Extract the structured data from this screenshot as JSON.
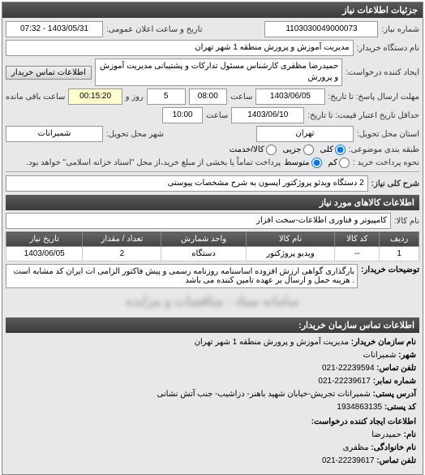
{
  "header": {
    "title": "جزئیات اطلاعات نیاز"
  },
  "fields": {
    "need_number_label": "شماره نیاز:",
    "need_number": "1103030049000073",
    "announce_datetime_label": "تاریخ و ساعت اعلان عمومی:",
    "announce_datetime": "1403/05/31 - 07:32",
    "buyer_org_label": "نام دستگاه خریدار:",
    "buyer_org": "مدیریت آموزش و پرورش منطقه 1 شهر تهران",
    "requester_label": "ایجاد کننده درخواست:",
    "requester": "حمیدرضا مظفری کارشناس مسئول تدارکات و پشتیبانی مدیریت آموزش و پرورش",
    "contact_btn": "اطلاعات تماس خریدار",
    "deadline_label": "مهلت ارسال پاسخ: تا تاریخ:",
    "deadline_date": "1403/06/05",
    "deadline_time_label": "ساعت",
    "deadline_time": "08:00",
    "remaining_days": "5",
    "remaining_days_label": "روز و",
    "remaining_time": "00:15:20",
    "remaining_label": "ساعت باقی مانده",
    "validity_label": "حداقل تاریخ اعتبار قیمت: تا تاریخ:",
    "validity_date": "1403/06/10",
    "validity_time_label": "ساعت",
    "validity_time": "10:00",
    "province_label": "استان محل تحویل:",
    "province": "تهران",
    "city_label": "شهر محل تحویل:",
    "city": "شمیرانات",
    "group_label": "طبقه بندی موضوعی:",
    "radio_all": "کلی",
    "radio_partial": "جزیی",
    "radio_both": "کالا/خدمت",
    "pay_label": "نحوه پرداخت خرید :",
    "radio_low": "کم",
    "radio_med": "متوسط",
    "pay_note": "پرداخت تماماً یا بخشی از مبلغ خرید،از محل \"اسناد خزانه اسلامی\" خواهد بود.",
    "need_title_label": "شرح کلی نیاز:",
    "need_title": "2 دستگاه ویدئو پروژکتور اپسون به شرح مشخصات پیوستی"
  },
  "goods_section": {
    "title": "اطلاعات کالاهای مورد نیاز",
    "category_label": "نام کالا:",
    "category": "کامپیوتر و فناوری اطلاعات-سخت افزار"
  },
  "table": {
    "headers": [
      "ردیف",
      "کد کالا",
      "نام کالا",
      "واحد شمارش",
      "تعداد / مقدار",
      "تاریخ نیاز"
    ],
    "rows": [
      {
        "row": "1",
        "code": "--",
        "name": "ویدیو پروژکتور",
        "unit": "دستگاه",
        "qty": "2",
        "date": "1403/06/05"
      }
    ]
  },
  "notes": {
    "label": "توضیحات خریدار:",
    "text": "بارگذاری گواهی ارزش افزوده اساسنامه روزنامه رسمی و پیش فاکتور الزامی ات ایران کد مشابه است . هزینه حمل و ارسال بر عهده تامین کننده می باشد"
  },
  "blurred_text": "سامانه ستاد - مناقصات و مزایده",
  "contact": {
    "title": "اطلاعات تماس سازمان خریدار:",
    "org_label": "نام سازمان خریدار:",
    "org": "مدیریت آموزش و پرورش منطقه 1 شهر تهران",
    "city_label": "شهر:",
    "city": "شمیرانات",
    "tel_label": "تلفن تماس:",
    "tel": "22239594-021",
    "fax_label": "شماره نمابر:",
    "fax": "22239617-021",
    "addr_label": "آدرس پستی:",
    "addr": "شمیرانات تجریش-خیابان شهید باهنر- دزاشیب- جنب آتش نشانی",
    "postal_label": "کد پستی:",
    "postal": "1934863135",
    "creator_title": "اطلاعات ایجاد کننده درخواست:",
    "name_label": "نام:",
    "name": "حمیدرضا",
    "family_label": "نام خانوادگی:",
    "family": "مظفری",
    "phone_label": "تلفن تماس:",
    "phone": "22239617-021"
  }
}
